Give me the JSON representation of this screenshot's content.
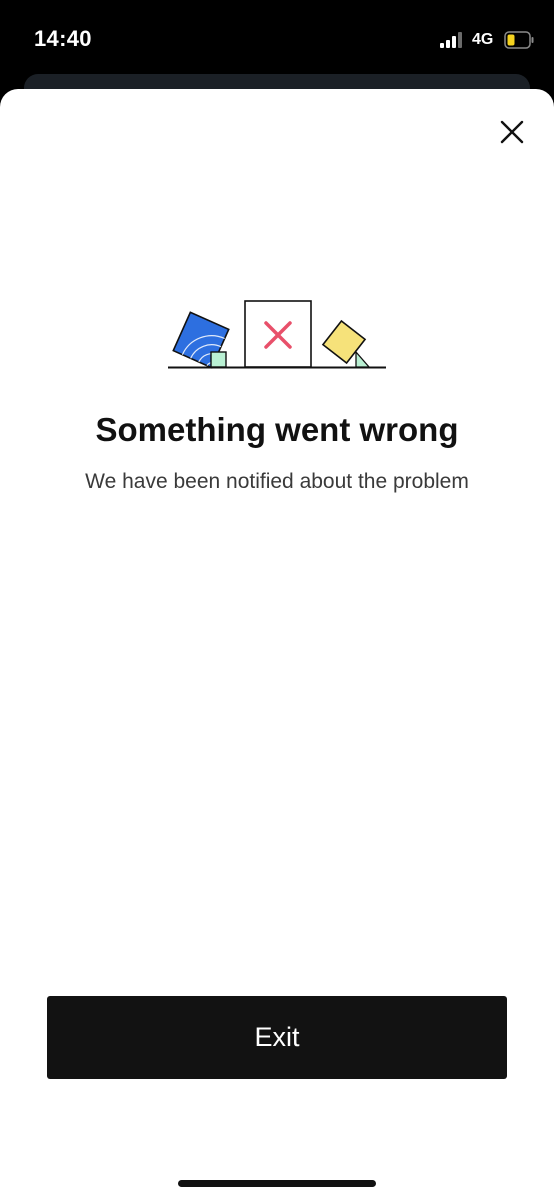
{
  "status_bar": {
    "time": "14:40",
    "network": "4G",
    "battery_color": "#f4d21f"
  },
  "dialog": {
    "title": "Something went wrong",
    "subtitle": "We have been notified about the problem",
    "exit_label": "Exit"
  },
  "colors": {
    "error_x": "#e8506a",
    "blue_card": "#2d6fe0",
    "yellow_card": "#f6e27a",
    "mint_block": "#b9f0d3",
    "button_bg": "#121212"
  }
}
